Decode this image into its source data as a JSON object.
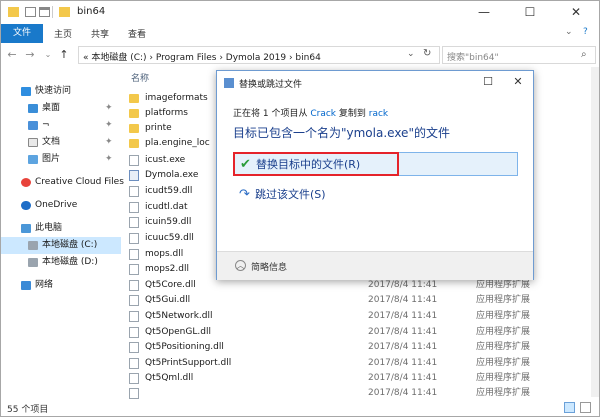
{
  "window": {
    "title": "bin64",
    "controls": {
      "minimize": "—",
      "maximize": "☐",
      "close": "✕"
    }
  },
  "ribbon": {
    "file_tab": "文件",
    "tabs": [
      "主页",
      "共享",
      "查看"
    ],
    "help": "?"
  },
  "addressbar": {
    "path": "« 本地磁盘 (C:) › Program Files › Dymola 2019 › bin64",
    "search_placeholder": "搜索\"bin64\""
  },
  "navpane": {
    "items": [
      {
        "label": "快速访问",
        "icon": "star-icon",
        "pinned": false
      },
      {
        "label": "桌面",
        "icon": "desktop-icon",
        "pinned": true
      },
      {
        "label": "¬",
        "icon": "download-icon",
        "pinned": true
      },
      {
        "label": "文档",
        "icon": "documents-icon",
        "pinned": true
      },
      {
        "label": "图片",
        "icon": "pictures-icon",
        "pinned": true
      },
      {
        "label": "Creative Cloud Files",
        "icon": "creative-cloud-icon",
        "pinned": false
      },
      {
        "label": "OneDrive",
        "icon": "onedrive-icon",
        "pinned": false
      },
      {
        "label": "此电脑",
        "icon": "computer-icon",
        "pinned": false
      },
      {
        "label": "本地磁盘 (C:)",
        "icon": "drive-icon",
        "pinned": false,
        "selected": true
      },
      {
        "label": "本地磁盘 (D:)",
        "icon": "drive-icon",
        "pinned": false
      },
      {
        "label": "网络",
        "icon": "network-icon",
        "pinned": false
      }
    ]
  },
  "filelist": {
    "header_name": "名称",
    "rows": [
      {
        "name": "imageformats",
        "date": "",
        "type": "",
        "kind": "folder"
      },
      {
        "name": "platforms",
        "date": "",
        "type": "",
        "kind": "folder"
      },
      {
        "name": "printe",
        "date": "",
        "type": "",
        "kind": "folder"
      },
      {
        "name": "pla.engine_loc",
        "date": "",
        "type": "",
        "kind": "folder"
      },
      {
        "name": "icust.exe",
        "date": "",
        "type": "",
        "kind": "doc"
      },
      {
        "name": "Dymola.exe",
        "date": "",
        "type": "",
        "kind": "exe"
      },
      {
        "name": "icudt59.dll",
        "date": "",
        "type": "",
        "kind": "doc"
      },
      {
        "name": "icudtl.dat",
        "date": "",
        "type": "",
        "kind": "doc"
      },
      {
        "name": "icuin59.dll",
        "date": "",
        "type": "",
        "kind": "doc"
      },
      {
        "name": "icuuc59.dll",
        "date": "",
        "type": "",
        "kind": "doc"
      },
      {
        "name": "mops.dll",
        "date": "",
        "type": "",
        "kind": "doc"
      },
      {
        "name": "mops2.dll",
        "date": "",
        "type": "",
        "kind": "doc"
      },
      {
        "name": "Qt5Core.dll",
        "date": "2017/8/4 11:41",
        "type": "应用程序扩展",
        "kind": "doc"
      },
      {
        "name": "Qt5Gui.dll",
        "date": "2017/8/4 11:41",
        "type": "应用程序扩展",
        "kind": "doc"
      },
      {
        "name": "Qt5Network.dll",
        "date": "2017/8/4 11:41",
        "type": "应用程序扩展",
        "kind": "doc"
      },
      {
        "name": "Qt5OpenGL.dll",
        "date": "2017/8/4 11:41",
        "type": "应用程序扩展",
        "kind": "doc"
      },
      {
        "name": "Qt5Positioning.dll",
        "date": "2017/8/4 11:41",
        "type": "应用程序扩展",
        "kind": "doc"
      },
      {
        "name": "Qt5PrintSupport.dll",
        "date": "2017/8/4 11:41",
        "type": "应用程序扩展",
        "kind": "doc"
      },
      {
        "name": "Qt5Qml.dll",
        "date": "2017/8/4 11:41",
        "type": "应用程序扩展",
        "kind": "doc"
      },
      {
        "name": "",
        "date": "2017/8/4 11:41",
        "type": "应用程序扩展",
        "kind": "doc"
      }
    ]
  },
  "status": {
    "count": "55 个项目"
  },
  "dialog": {
    "title": "替换或跳过文件",
    "line1_prefix": "正在将 1 个项目从",
    "line1_src": "Crack",
    "line1_mid": "复制到",
    "line1_dst": "rack",
    "line2": "目标已包含一个名为\"ymola.exe\"的文件",
    "option_replace": "替换目标中的文件(R)",
    "option_skip": "跳过该文件(S)",
    "details": "简略信息",
    "controls": {
      "maximize": "☐",
      "close": "✕"
    }
  }
}
